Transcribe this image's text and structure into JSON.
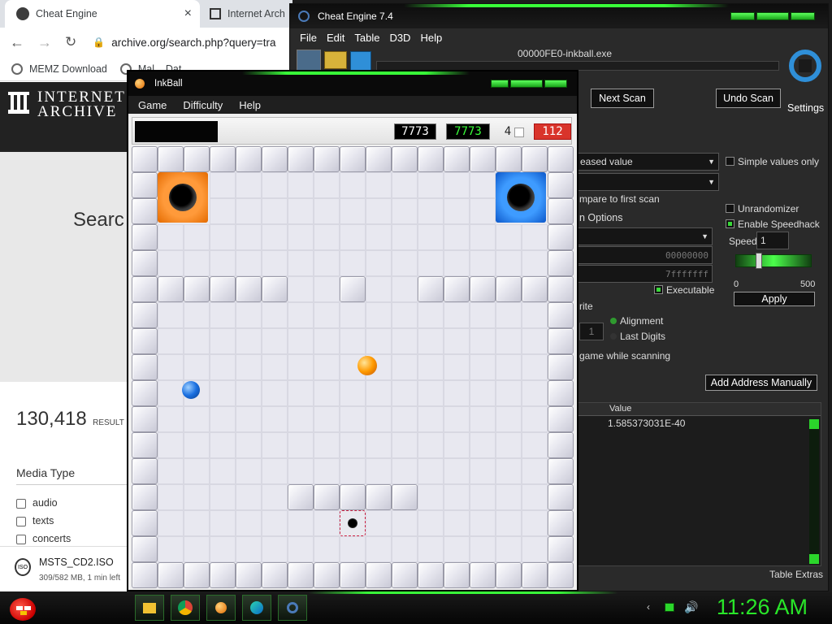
{
  "browser": {
    "tabs": [
      {
        "label": "Cheat Engine",
        "close": "×"
      },
      {
        "label": "Internet Arch"
      }
    ],
    "url": "archive.org/search.php?query=tra",
    "bookmarks": [
      {
        "label": "MEMZ Download"
      },
      {
        "label": "Mal... Dat..."
      }
    ],
    "logo_line1": "INTERNET",
    "logo_line2": "ARCHIVE",
    "search_heading": "Searc",
    "results_count": "130,418",
    "results_label": "RESULT",
    "media_type_heading": "Media Type",
    "media_types": [
      "audio",
      "texts",
      "concerts"
    ],
    "download": {
      "filename": "MSTS_CD2.ISO",
      "status": "309/582 MB, 1 min left",
      "icon_text": "ISO"
    }
  },
  "cheat_engine": {
    "title": "Cheat Engine 7.4",
    "menu": [
      "File",
      "Edit",
      "Table",
      "D3D",
      "Help"
    ],
    "process": "00000FE0-inkball.exe",
    "next_scan": "Next Scan",
    "undo_scan": "Undo Scan",
    "settings": "Settings",
    "scan_type": "eased value",
    "compare_first": "mpare to first scan",
    "simple_values": "Simple values only",
    "memory_options": "n Options",
    "start_addr": "00000000",
    "stop_addr": "7fffffff",
    "executable": "Executable",
    "writable": "rite",
    "alignment": "Alignment",
    "last_digits": "Last Digits",
    "align_value": "1",
    "pause_game": "game while scanning",
    "unrandomizer": "Unrandomizer",
    "enable_speedhack": "Enable Speedhack",
    "speed_label": "Speed",
    "speed_value": "1",
    "slider_min": "0",
    "slider_max": "500",
    "apply": "Apply",
    "add_address": "Add Address Manually",
    "value_header": "Value",
    "row_value": "1.585373031E-40",
    "table_extras": "Table Extras"
  },
  "inkball": {
    "title": "InkBall",
    "menu": [
      "Game",
      "Difficulty",
      "Help"
    ],
    "score": "7773",
    "high_score": "7773",
    "balls_left": "4",
    "time": "112",
    "colors": {
      "score_bg": "#000000",
      "score_text": "#ffffff",
      "high_text": "#39ff39",
      "time_bg": "#d9342b"
    }
  },
  "taskbar": {
    "clock": "11:26 AM",
    "apps": [
      "start-icon",
      "file-explorer-icon",
      "chrome-icon",
      "inkball-icon",
      "edge-icon",
      "cheat-engine-icon"
    ]
  }
}
